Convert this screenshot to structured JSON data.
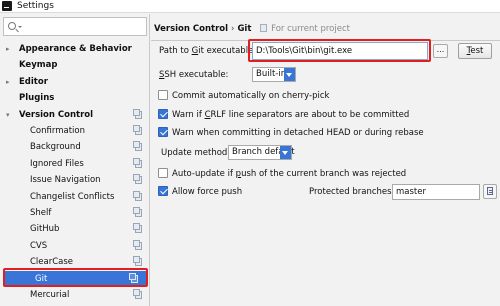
{
  "window": {
    "title": "Settings"
  },
  "sidebar": {
    "search_value": "",
    "items": [
      {
        "label": "Appearance & Behavior",
        "level": "top",
        "expandable": true,
        "expanded": false,
        "project": false
      },
      {
        "label": "Keymap",
        "level": "top",
        "expandable": false,
        "project": false
      },
      {
        "label": "Editor",
        "level": "top",
        "expandable": true,
        "expanded": false,
        "project": false
      },
      {
        "label": "Plugins",
        "level": "top",
        "expandable": false,
        "project": false
      },
      {
        "label": "Version Control",
        "level": "top",
        "expandable": true,
        "expanded": true,
        "project": true
      },
      {
        "label": "Confirmation",
        "level": "child",
        "project": true
      },
      {
        "label": "Background",
        "level": "child",
        "project": true
      },
      {
        "label": "Ignored Files",
        "level": "child",
        "project": true
      },
      {
        "label": "Issue Navigation",
        "level": "child",
        "project": true
      },
      {
        "label": "Changelist Conflicts",
        "level": "child",
        "project": true
      },
      {
        "label": "Shelf",
        "level": "child",
        "project": true
      },
      {
        "label": "GitHub",
        "level": "child",
        "project": true
      },
      {
        "label": "CVS",
        "level": "child",
        "project": true
      },
      {
        "label": "ClearCase",
        "level": "child",
        "project": true
      },
      {
        "label": "Git",
        "level": "child",
        "project": true,
        "selected": true
      },
      {
        "label": "Mercurial",
        "level": "child",
        "project": true
      }
    ]
  },
  "breadcrumb": {
    "parent": "Version Control",
    "separator": "›",
    "current": "Git",
    "scope_note": "For current project"
  },
  "git": {
    "path_label": "Path to Git executable:",
    "path_value": "D:\\Tools\\Git\\bin\\git.exe",
    "browse_label": "...",
    "test_label": "Test",
    "ssh_label": "SSH executable:",
    "ssh_value": "Built-in",
    "commit_cherry_pick_label": "Commit automatically on cherry-pick",
    "commit_cherry_pick_checked": false,
    "warn_crlf_label": "Warn if CRLF line separators are about to be committed",
    "warn_crlf_checked": true,
    "warn_detached_label": "Warn when committing in detached HEAD or during rebase",
    "warn_detached_checked": true,
    "update_method_label": "Update method:",
    "update_method_value": "Branch default",
    "auto_update_label": "Auto-update if push of the current branch was rejected",
    "auto_update_checked": false,
    "allow_force_push_label": "Allow force push",
    "allow_force_push_checked": true,
    "protected_branches_label": "Protected branches:",
    "protected_branches_value": "master"
  },
  "colors": {
    "selection": "#3875d7",
    "highlight_outline": "#e02020"
  }
}
